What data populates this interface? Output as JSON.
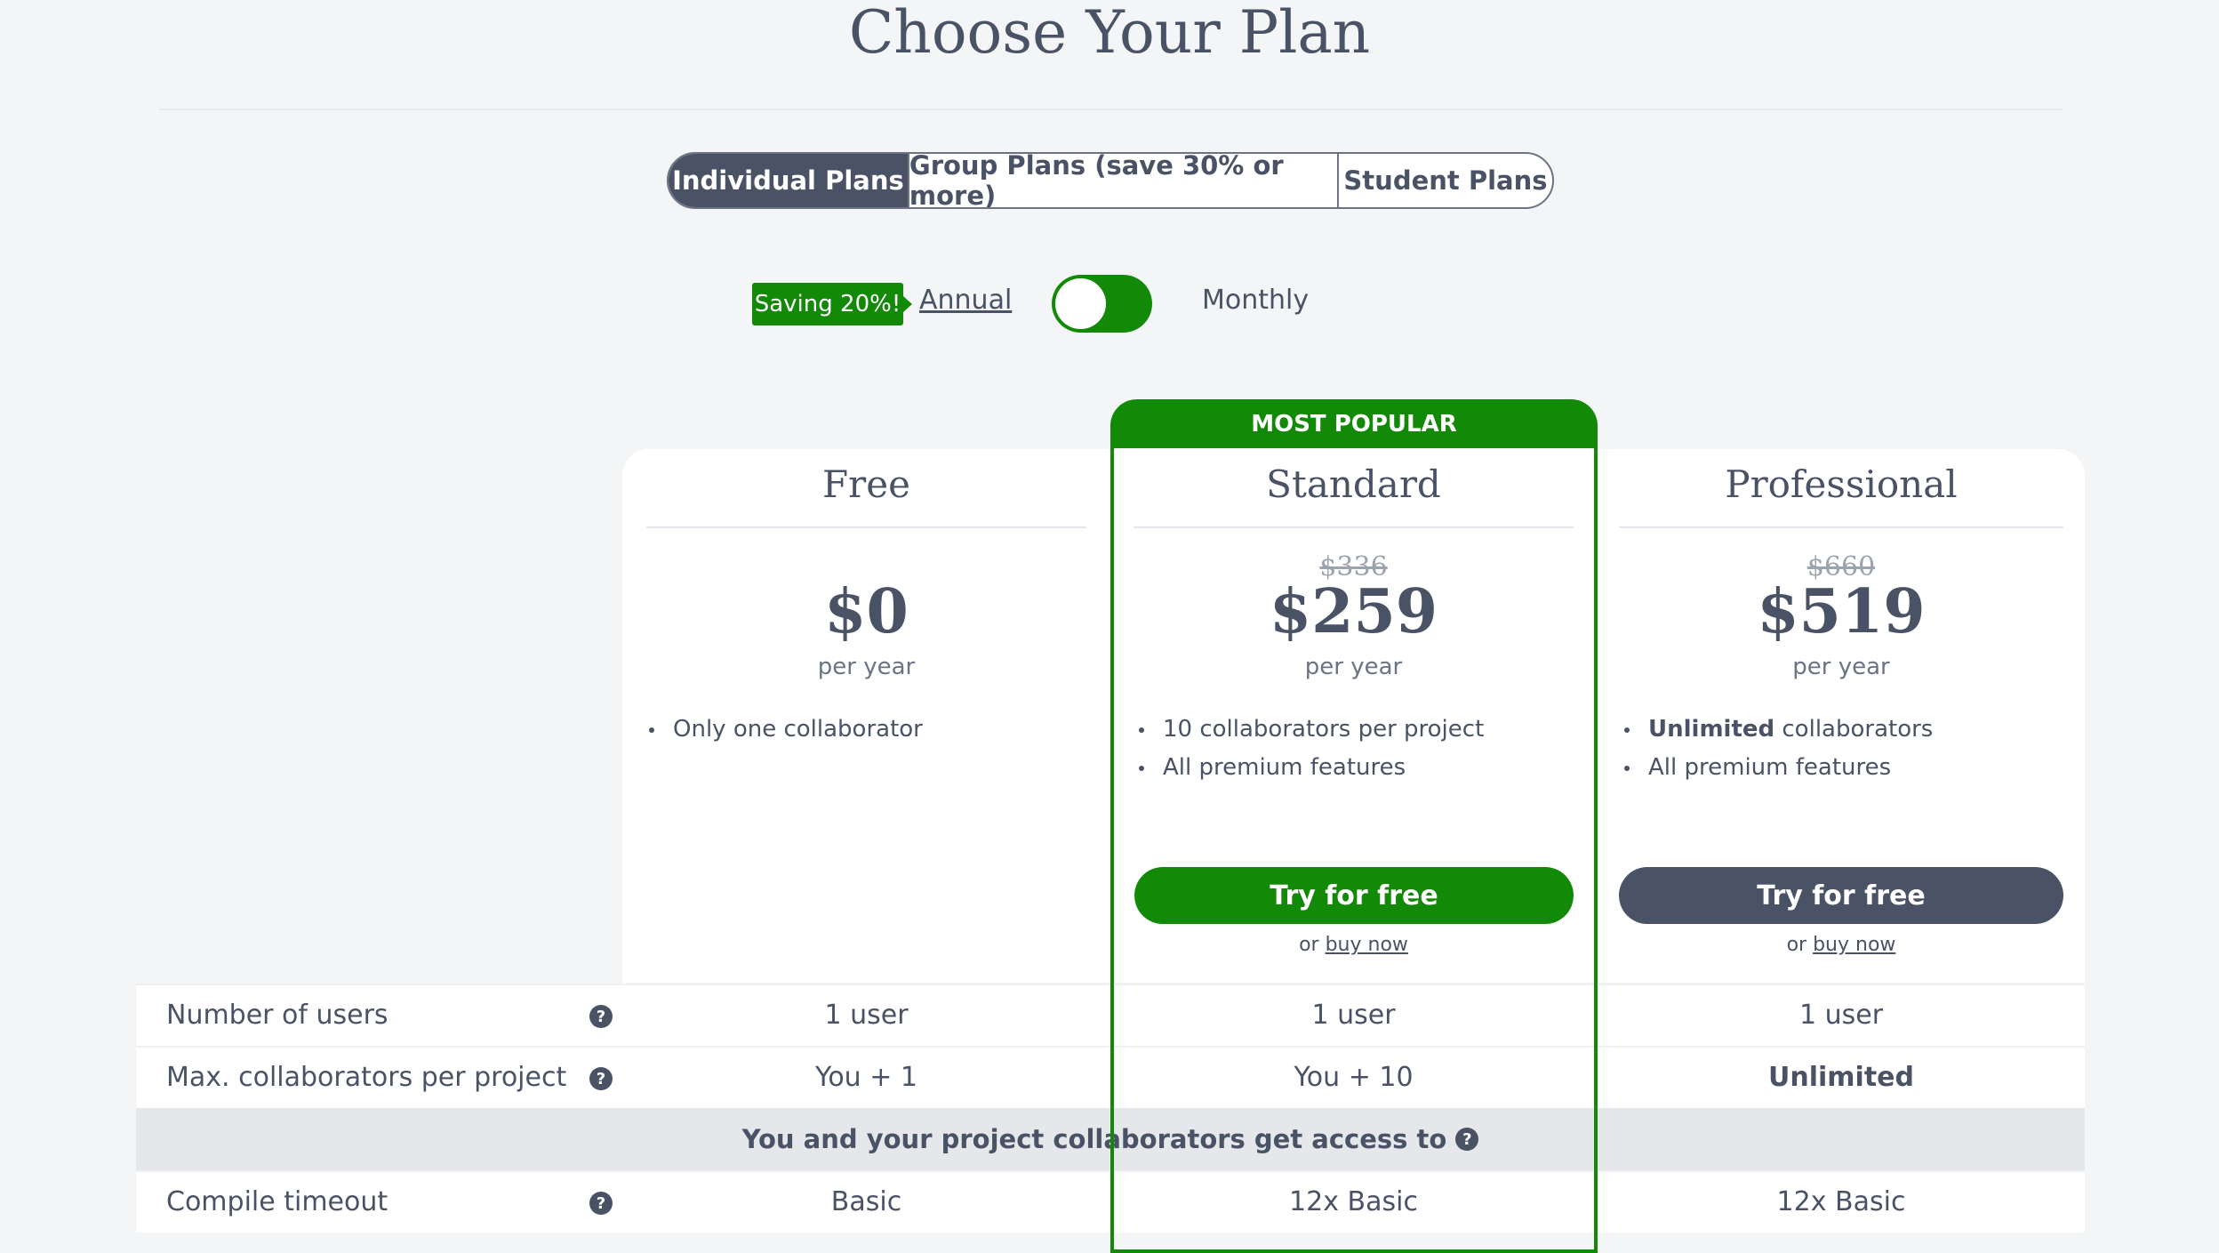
{
  "page": {
    "title": "Choose Your Plan"
  },
  "plan_tabs": [
    {
      "label": "Individual Plans",
      "active": true
    },
    {
      "label": "Group Plans (save 30% or more)",
      "active": false
    },
    {
      "label": "Student Plans",
      "active": false
    }
  ],
  "billing": {
    "saving_badge": "Saving 20%!",
    "annual_label": "Annual",
    "monthly_label": "Monthly",
    "selected": "Annual"
  },
  "plans": [
    {
      "name": "Free",
      "old_price": "",
      "price": "$0",
      "period": "per year",
      "features": [
        "Only one collaborator"
      ],
      "cta": "",
      "buy_prefix": "",
      "buy_link": ""
    },
    {
      "name": "Standard",
      "badge": "MOST POPULAR",
      "old_price": "$336",
      "price": "$259",
      "period": "per year",
      "features": [
        "10 collaborators per project",
        "All premium features"
      ],
      "cta": "Try for free",
      "buy_prefix": "or ",
      "buy_link": "buy now"
    },
    {
      "name": "Professional",
      "old_price": "$660",
      "price": "$519",
      "period": "per year",
      "features_bold_prefix": "Unlimited",
      "features": [
        " collaborators",
        "All premium features"
      ],
      "cta": "Try for free",
      "buy_prefix": "or ",
      "buy_link": "buy now"
    }
  ],
  "table": {
    "rows": [
      {
        "label": "Number of users",
        "values": [
          "1 user",
          "1 user",
          "1 user"
        ]
      },
      {
        "label": "Max. collaborators per project",
        "values": [
          "You + 1",
          "You + 10",
          "Unlimited"
        ]
      }
    ],
    "section_header": "You and your project collaborators get access to",
    "rows_after": [
      {
        "label": "Compile timeout",
        "values": [
          "Basic",
          "12x Basic",
          "12x Basic"
        ]
      }
    ]
  },
  "colors": {
    "accent_green": "#138a07",
    "slate": "#495365",
    "background": "#f4f5f6"
  },
  "icons": {
    "help": "question-circle-icon"
  }
}
